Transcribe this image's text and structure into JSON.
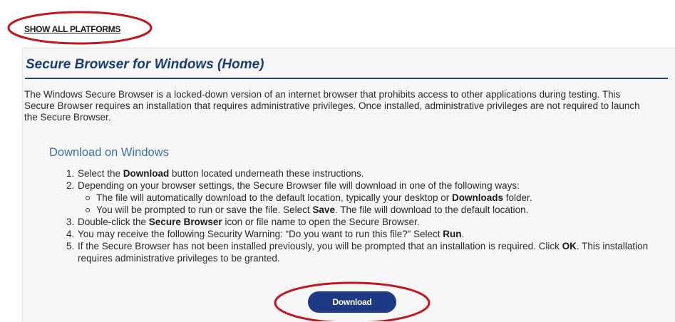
{
  "header": {
    "show_all_platforms_label": "SHOW ALL PLATFORMS"
  },
  "panel": {
    "title": "Secure Browser for Windows (Home)",
    "intro": "The Windows Secure Browser is a locked-down version of an internet browser that prohibits access to other applications during testing. This Secure Browser requires an installation that requires administrative privileges. Once installed, administrative privileges are not required to launch the Secure Browser.",
    "section_title": "Download on Windows",
    "steps": {
      "s1": {
        "a": "Select the ",
        "b": "Download",
        "c": " button located underneath these instructions."
      },
      "s2": {
        "a": "Depending on your browser settings, the Secure Browser file will download in one of the following ways:"
      },
      "s2_sub1": {
        "a": "The file will automatically download to the default location, typically your desktop or ",
        "b": "Downloads",
        "c": " folder."
      },
      "s2_sub2": {
        "a": "You will be prompted to run or save the file. Select ",
        "b": "Save",
        "c": ". The file will download to the default location."
      },
      "s3": {
        "a": "Double-click the ",
        "b": "Secure Browser",
        "c": " icon or file name to open the Secure Browser."
      },
      "s4": {
        "a": "You may receive the following Security Warning: “Do you want to run this file?” Select ",
        "b": "Run",
        "c": "."
      },
      "s5": {
        "a": "If the Secure Browser has not been installed previously, you will be prompted that an installation is required. Click ",
        "b": "OK",
        "c": ". This installation requires administrative privileges to be granted."
      }
    },
    "download_button_label": "Download"
  },
  "colors": {
    "title_blue": "#1a3b7c",
    "section_blue": "#3a6fa8",
    "button_blue": "#1e3a85",
    "annotation_red": "#c0181e"
  }
}
